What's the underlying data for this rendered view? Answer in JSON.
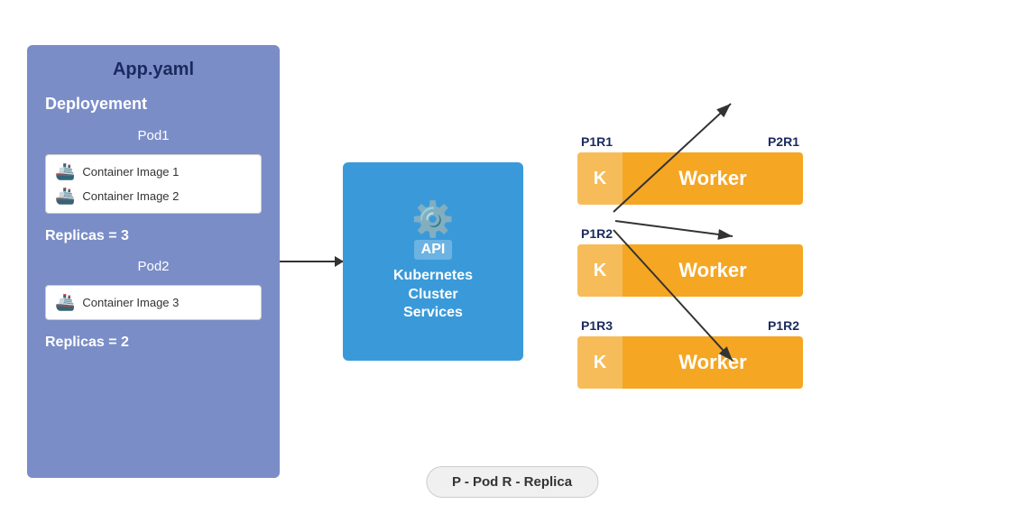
{
  "appYaml": {
    "title": "App.yaml",
    "deployment": "Deployement",
    "pod1": {
      "label": "Pod1",
      "containers": [
        {
          "label": "Container Image 1",
          "icon": "🏗"
        },
        {
          "label": "Container Image 2",
          "icon": "🏗"
        }
      ]
    },
    "replicas1": "Replicas = 3",
    "pod2": {
      "label": "Pod2",
      "containers": [
        {
          "label": "Container Image 3",
          "icon": "🏗"
        }
      ]
    },
    "replicas2": "Replicas = 2"
  },
  "kubernetes": {
    "api_label": "API",
    "title": "Kubernetes\nCluster\nServices",
    "icon": "⚙"
  },
  "workers": [
    {
      "left_label": "P1R1",
      "right_label": "P2R1",
      "k": "K",
      "text": "Worker"
    },
    {
      "left_label": "P1R2",
      "right_label": "",
      "k": "K",
      "text": "Worker"
    },
    {
      "left_label": "P1R3",
      "right_label": "P1R2",
      "k": "K",
      "text": "Worker"
    }
  ],
  "legend": "P - Pod   R - Replica"
}
